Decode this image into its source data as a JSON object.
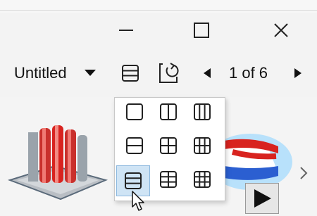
{
  "window": {
    "controls": [
      "minimize",
      "maximize",
      "close"
    ]
  },
  "toolbar": {
    "view_label": "Untitled",
    "page_indicator": "1 of 6",
    "icons": [
      "layout-icon",
      "refresh-view-icon",
      "previous-page-icon",
      "next-page-icon"
    ]
  },
  "layout_menu": {
    "options": [
      "1x1",
      "1x2",
      "1x3",
      "2x1",
      "2x2",
      "2x3",
      "3x1",
      "3x2",
      "3x3"
    ],
    "selected": "3x1"
  },
  "viewport": {
    "models": [
      "extruded-fins-model",
      "red-blue-box-model"
    ],
    "controls": [
      "next-view-arrow",
      "play-animation-button"
    ]
  },
  "colors": {
    "accent": "#cfe4f5",
    "model_red": "#d8231f",
    "model_blue": "#2b5fd1"
  }
}
